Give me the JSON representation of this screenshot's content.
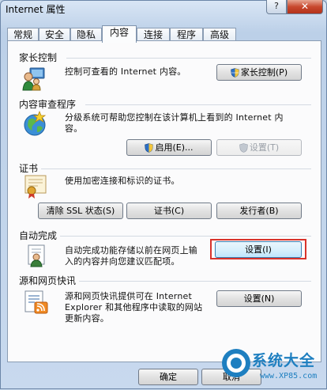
{
  "window": {
    "title": "Internet 属性",
    "help_label": "?",
    "close_label": "✕"
  },
  "tabs": [
    {
      "label": "常规"
    },
    {
      "label": "安全"
    },
    {
      "label": "隐私"
    },
    {
      "label": "内容",
      "active": true
    },
    {
      "label": "连接"
    },
    {
      "label": "程序"
    },
    {
      "label": "高级"
    }
  ],
  "parental": {
    "title": "家长控制",
    "desc": "控制可查看的 Internet 内容。",
    "button": "家长控制(P)"
  },
  "advisor": {
    "title": "内容审查程序",
    "desc_line1": "分级系统可帮助您控制在该计算机上看到的 Internet 内",
    "desc_line2": "容。",
    "enable_button": "启用(E)...",
    "settings_button": "设置(T)"
  },
  "certs": {
    "title": "证书",
    "desc": "使用加密连接和标识的证书。",
    "clear_ssl_button": "清除 SSL 状态(S)",
    "certs_button": "证书(C)",
    "publishers_button": "发行者(B)"
  },
  "autocomplete": {
    "title": "自动完成",
    "desc_line1": "自动完成功能存储以前在网页上输",
    "desc_line2": "入的内容并向您建议匹配项。",
    "settings_button": "设置(I)"
  },
  "feeds": {
    "title": "源和网页快讯",
    "desc_line1": "源和网页快讯提供可在 Internet",
    "desc_line2": "Explorer 和其他程序中读取的网站",
    "desc_line3": "更新内容。",
    "settings_button": "设置(N)"
  },
  "footer": {
    "ok_button": "确定",
    "cancel_button": "取消"
  },
  "watermark": {
    "text": "系统大全",
    "sub": "www.XP85.com"
  },
  "colors": {
    "highlight": "#d8332b",
    "watermark": "#1e7fc0"
  }
}
